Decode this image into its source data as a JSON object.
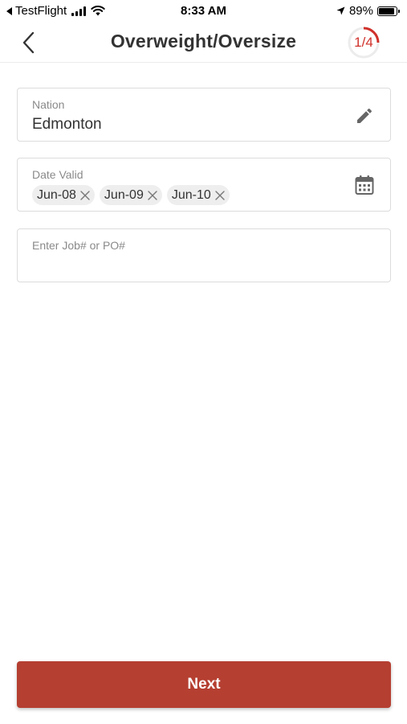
{
  "status_bar": {
    "back_app": "TestFlight",
    "time": "8:33 AM",
    "battery": "89%",
    "battery_level": 0.89
  },
  "header": {
    "title": "Overweight/Oversize",
    "step": "1/4",
    "step_progress": 0.25,
    "accent_color": "#d0302a"
  },
  "form": {
    "nation": {
      "label": "Nation",
      "value": "Edmonton",
      "icon": "pencil-icon"
    },
    "date_valid": {
      "label": "Date Valid",
      "chips": [
        "Jun-08",
        "Jun-09",
        "Jun-10"
      ],
      "icon": "calendar-icon"
    },
    "job_po": {
      "placeholder": "Enter Job# or PO#"
    }
  },
  "footer": {
    "next_label": "Next",
    "button_color": "#b53f31"
  }
}
